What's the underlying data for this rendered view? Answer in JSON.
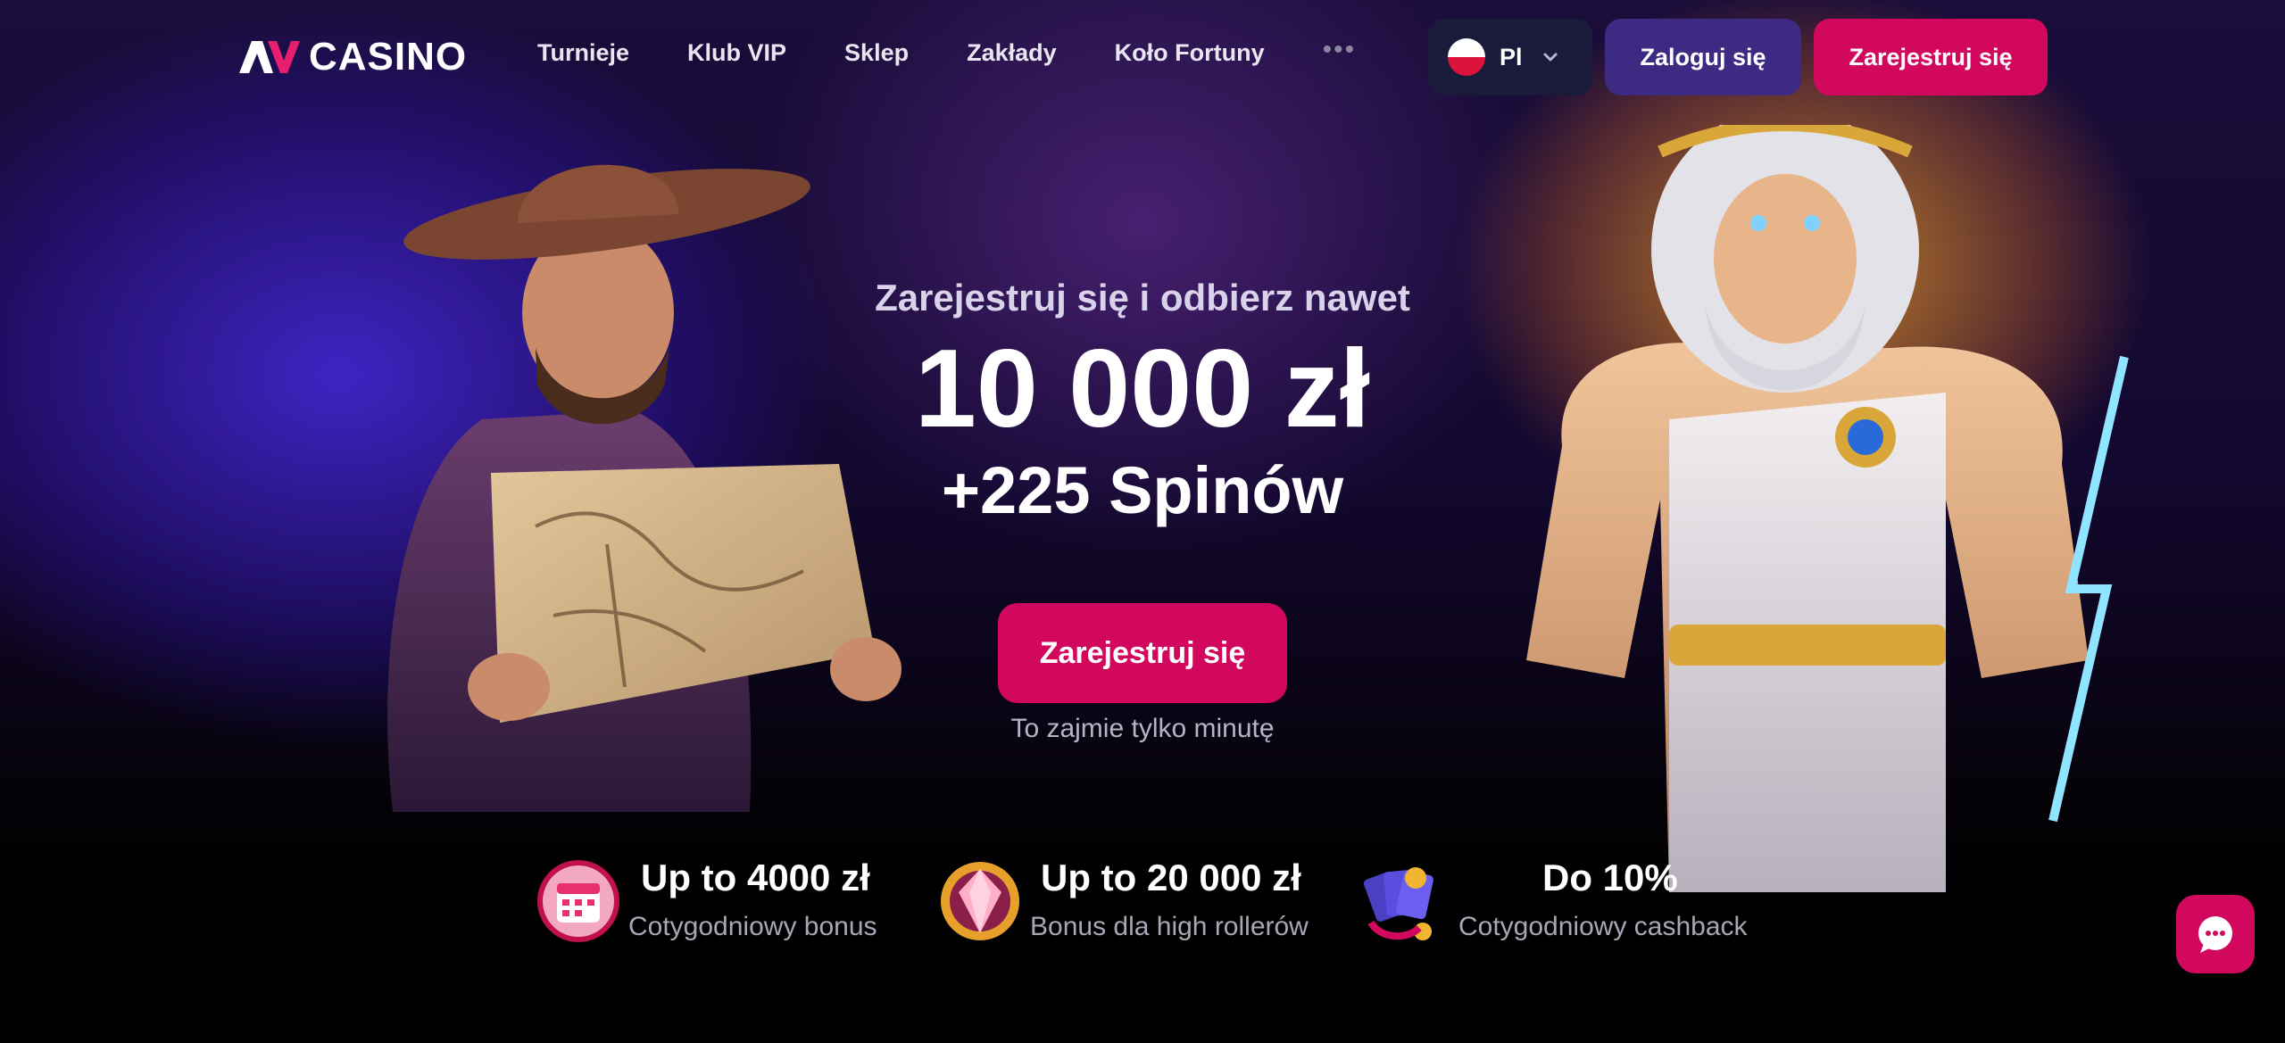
{
  "brand": {
    "logo_mark": "AV",
    "name": "CASINO"
  },
  "nav": {
    "items": [
      {
        "label": "Turnieje"
      },
      {
        "label": "Klub VIP"
      },
      {
        "label": "Sklep"
      },
      {
        "label": "Zakłady"
      },
      {
        "label": "Koło Fortuny"
      }
    ],
    "more_icon": "ellipsis-icon"
  },
  "language": {
    "label": "Pl",
    "flag": "poland-flag-icon"
  },
  "auth": {
    "login_label": "Zaloguj się",
    "register_label": "Zarejestruj się"
  },
  "hero": {
    "subtitle": "Zarejestruj się i odbierz nawet",
    "amount": "10 000 zł",
    "spins": "+225 Spinów",
    "cta_label": "Zarejestruj się",
    "note": "To zajmie tylko minutę"
  },
  "features": [
    {
      "title": "Up to 4000 zł",
      "desc": "Cotygodniowy bonus",
      "icon": "calendar-icon"
    },
    {
      "title": "Up to 20 000 zł",
      "desc": "Bonus dla high rollerów",
      "icon": "gem-icon"
    },
    {
      "title": "Do 10%",
      "desc": "Cotygodniowy cashback",
      "icon": "cards-cashback-icon"
    }
  ],
  "chat": {
    "icon": "chat-icon"
  },
  "colors": {
    "accent": "#d1085d",
    "login_bg": "#3d2a82",
    "lang_bg": "#1a1b3a"
  }
}
